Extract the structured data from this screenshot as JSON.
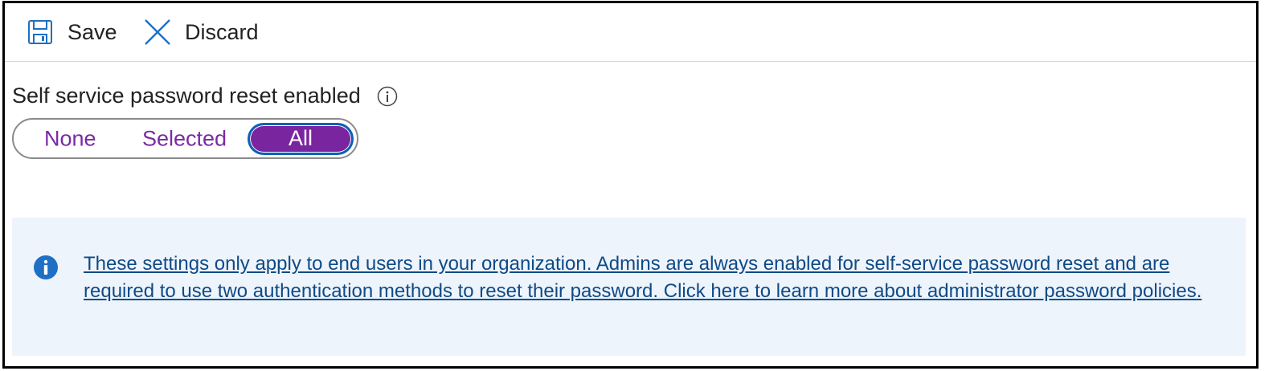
{
  "toolbar": {
    "save_label": "Save",
    "discard_label": "Discard"
  },
  "field": {
    "label": "Self service password reset enabled",
    "info_icon": "info-circle-icon"
  },
  "segmented": {
    "options": [
      "None",
      "Selected",
      "All"
    ],
    "selected": "All"
  },
  "banner": {
    "icon": "info-filled-icon",
    "text": "These settings only apply to end users in your organization. Admins are always enabled for self-service password reset and are required to use two authentication methods to reset their password. Click here to learn more about administrator password policies."
  },
  "colors": {
    "accent_purple": "#7a25a0",
    "focus_blue": "#0f5fb8",
    "link_blue": "#0f4a86",
    "banner_bg": "#eef4fb",
    "save_icon_blue": "#1f6fc4"
  }
}
